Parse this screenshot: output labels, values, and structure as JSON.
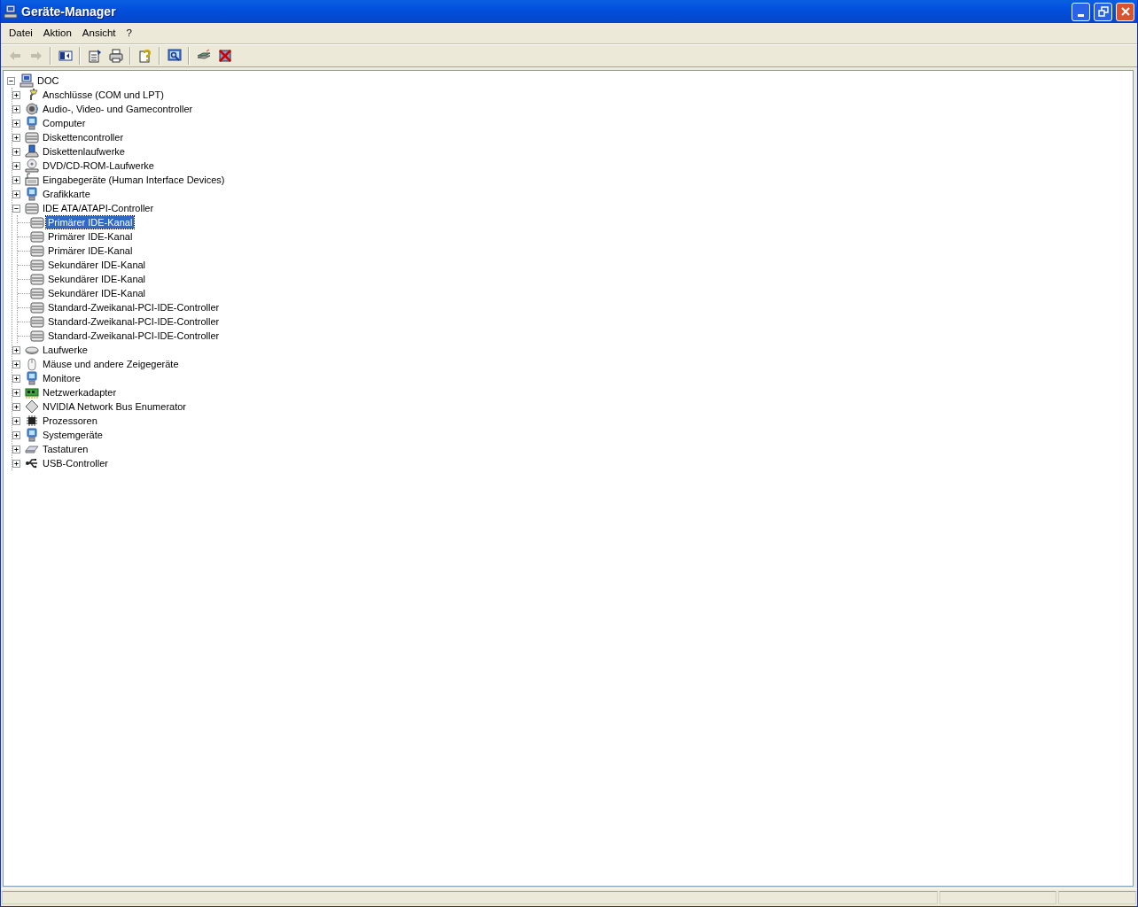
{
  "window": {
    "title": "Geräte-Manager"
  },
  "menu": [
    {
      "label": "Datei"
    },
    {
      "label": "Aktion"
    },
    {
      "label": "Ansicht"
    },
    {
      "label": "?"
    }
  ],
  "toolbar": [
    {
      "kind": "back",
      "disabled": true,
      "separator_before": false
    },
    {
      "kind": "forward",
      "disabled": true,
      "separator_before": false
    },
    {
      "kind": "tree",
      "disabled": false,
      "separator_before": true
    },
    {
      "kind": "properties",
      "disabled": false,
      "separator_before": true
    },
    {
      "kind": "print",
      "disabled": false,
      "separator_before": false
    },
    {
      "kind": "help",
      "disabled": false,
      "separator_before": true
    },
    {
      "kind": "scan",
      "disabled": false,
      "separator_before": true
    },
    {
      "kind": "update",
      "disabled": false,
      "separator_before": true
    },
    {
      "kind": "uninstall",
      "disabled": false,
      "separator_before": false
    }
  ],
  "tree": [
    {
      "label": "DOC",
      "kind": "computer",
      "expanded": true,
      "selected": false,
      "children": [
        {
          "label": "Anschlüsse (COM und LPT)",
          "kind": "connector",
          "expanded": false,
          "selected": false
        },
        {
          "label": "Audio-, Video- und Gamecontroller",
          "kind": "speaker",
          "expanded": false,
          "selected": false
        },
        {
          "label": "Computer",
          "kind": "monitor",
          "expanded": false,
          "selected": false
        },
        {
          "label": "Diskettencontroller",
          "kind": "drive",
          "expanded": false,
          "selected": false
        },
        {
          "label": "Diskettenlaufwerke",
          "kind": "floppy",
          "expanded": false,
          "selected": false
        },
        {
          "label": "DVD/CD-ROM-Laufwerke",
          "kind": "disc",
          "expanded": false,
          "selected": false
        },
        {
          "label": "Eingabegeräte (Human Interface Devices)",
          "kind": "input",
          "expanded": false,
          "selected": false
        },
        {
          "label": "Grafikkarte",
          "kind": "monitor",
          "expanded": false,
          "selected": false
        },
        {
          "label": "IDE ATA/ATAPI-Controller",
          "kind": "drive",
          "expanded": true,
          "selected": false,
          "children": [
            {
              "label": "Primärer IDE-Kanal",
              "kind": "drive",
              "selected": true
            },
            {
              "label": "Primärer IDE-Kanal",
              "kind": "drive",
              "selected": false
            },
            {
              "label": "Primärer IDE-Kanal",
              "kind": "drive",
              "selected": false
            },
            {
              "label": "Sekundärer IDE-Kanal",
              "kind": "drive",
              "selected": false
            },
            {
              "label": "Sekundärer IDE-Kanal",
              "kind": "drive",
              "selected": false
            },
            {
              "label": "Sekundärer IDE-Kanal",
              "kind": "drive",
              "selected": false
            },
            {
              "label": "Standard-Zweikanal-PCI-IDE-Controller",
              "kind": "drive",
              "selected": false
            },
            {
              "label": "Standard-Zweikanal-PCI-IDE-Controller",
              "kind": "drive",
              "selected": false
            },
            {
              "label": "Standard-Zweikanal-PCI-IDE-Controller",
              "kind": "drive",
              "selected": false
            }
          ]
        },
        {
          "label": "Laufwerke",
          "kind": "hdd",
          "expanded": false,
          "selected": false
        },
        {
          "label": "Mäuse und andere Zeigegeräte",
          "kind": "mouse",
          "expanded": false,
          "selected": false
        },
        {
          "label": "Monitore",
          "kind": "monitor",
          "expanded": false,
          "selected": false
        },
        {
          "label": "Netzwerkadapter",
          "kind": "network",
          "expanded": false,
          "selected": false
        },
        {
          "label": "NVIDIA Network Bus Enumerator",
          "kind": "diamond",
          "expanded": false,
          "selected": false
        },
        {
          "label": "Prozessoren",
          "kind": "chip",
          "expanded": false,
          "selected": false
        },
        {
          "label": "Systemgeräte",
          "kind": "monitor",
          "expanded": false,
          "selected": false
        },
        {
          "label": "Tastaturen",
          "kind": "keyboard",
          "expanded": false,
          "selected": false
        },
        {
          "label": "USB-Controller",
          "kind": "usb",
          "expanded": false,
          "selected": false
        }
      ]
    }
  ]
}
